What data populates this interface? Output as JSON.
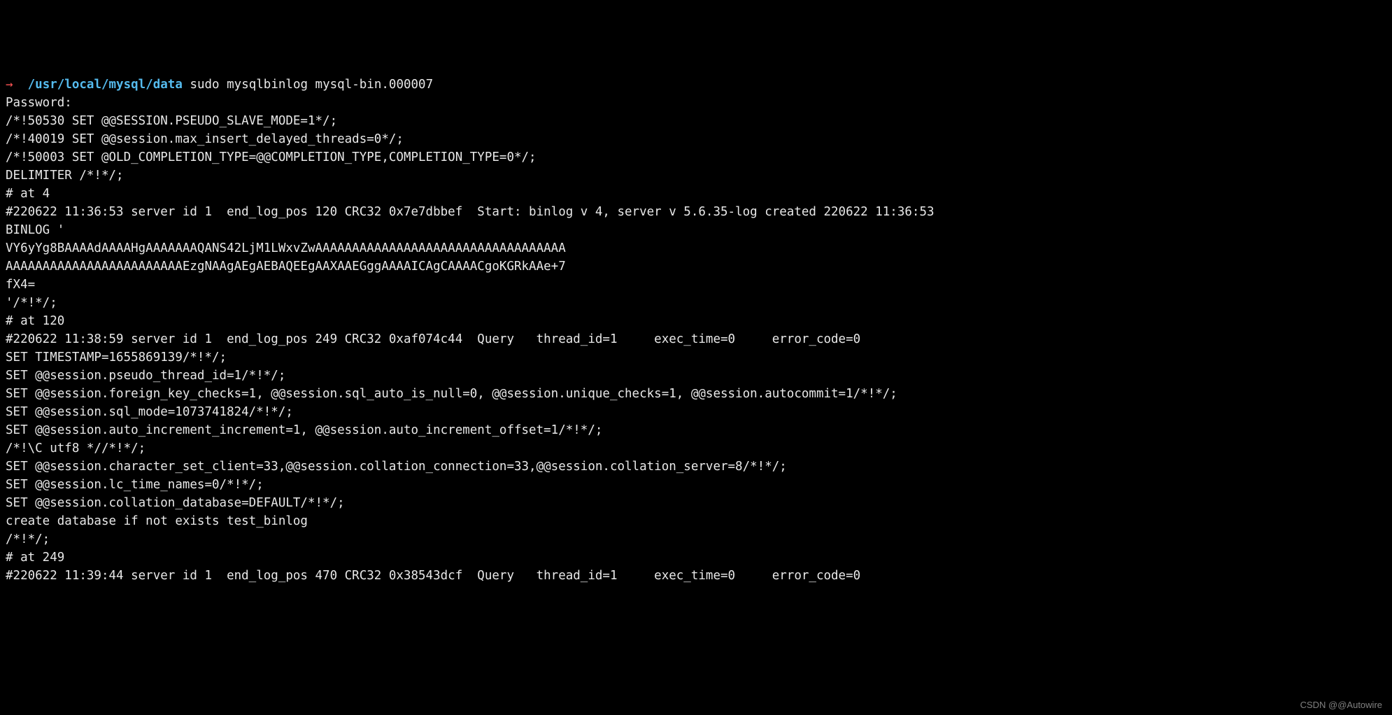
{
  "prompt": {
    "arrow": "→",
    "path": "/usr/local/mysql/data",
    "command": "sudo mysqlbinlog mysql-bin.000007"
  },
  "lines": [
    "Password:",
    "/*!50530 SET @@SESSION.PSEUDO_SLAVE_MODE=1*/;",
    "/*!40019 SET @@session.max_insert_delayed_threads=0*/;",
    "/*!50003 SET @OLD_COMPLETION_TYPE=@@COMPLETION_TYPE,COMPLETION_TYPE=0*/;",
    "DELIMITER /*!*/;",
    "# at 4",
    "#220622 11:36:53 server id 1  end_log_pos 120 CRC32 0x7e7dbbef  Start: binlog v 4, server v 5.6.35-log created 220622 11:36:53",
    "BINLOG '",
    "VY6yYg8BAAAAdAAAAHgAAAAAAAQANS42LjM1LWxvZwAAAAAAAAAAAAAAAAAAAAAAAAAAAAAAAAAA",
    "AAAAAAAAAAAAAAAAAAAAAAAAEzgNAAgAEgAEBAQEEgAAXAAEGggAAAAICAgCAAAACgoKGRkAAe+7",
    "fX4=",
    "'/*!*/;",
    "# at 120",
    "#220622 11:38:59 server id 1  end_log_pos 249 CRC32 0xaf074c44  Query   thread_id=1     exec_time=0     error_code=0",
    "SET TIMESTAMP=1655869139/*!*/;",
    "SET @@session.pseudo_thread_id=1/*!*/;",
    "SET @@session.foreign_key_checks=1, @@session.sql_auto_is_null=0, @@session.unique_checks=1, @@session.autocommit=1/*!*/;",
    "SET @@session.sql_mode=1073741824/*!*/;",
    "SET @@session.auto_increment_increment=1, @@session.auto_increment_offset=1/*!*/;",
    "/*!\\C utf8 *//*!*/;",
    "SET @@session.character_set_client=33,@@session.collation_connection=33,@@session.collation_server=8/*!*/;",
    "SET @@session.lc_time_names=0/*!*/;",
    "SET @@session.collation_database=DEFAULT/*!*/;",
    "create database if not exists test_binlog",
    "/*!*/;",
    "# at 249",
    "#220622 11:39:44 server id 1  end_log_pos 470 CRC32 0x38543dcf  Query   thread_id=1     exec_time=0     error_code=0"
  ],
  "watermark": "CSDN @@Autowire"
}
